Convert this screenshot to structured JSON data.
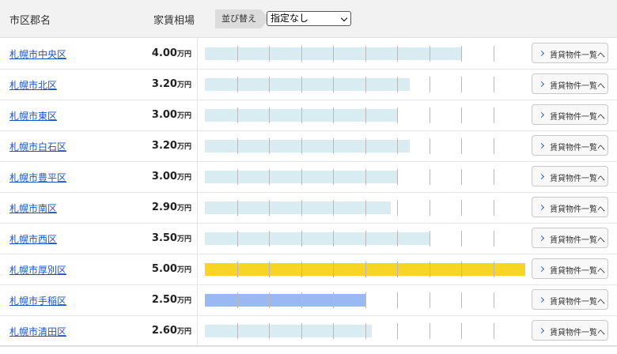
{
  "header": {
    "ward_column": "市区郡名",
    "rent_column": "家賃相場",
    "sort_label": "並び替え",
    "sort_selected": "指定なし"
  },
  "unit": "万円",
  "scale_max": 5.0,
  "bar_colors": {
    "default": "#d8ecf2",
    "max": "#f7d524",
    "min": "#9ab8f2"
  },
  "rows": [
    {
      "ward": "札幌市中央区",
      "rent": "4.00",
      "value": 4.0,
      "button": "賃貸物件一覧へ",
      "highlight": "default"
    },
    {
      "ward": "札幌市北区",
      "rent": "3.20",
      "value": 3.2,
      "button": "賃貸物件一覧へ",
      "highlight": "default"
    },
    {
      "ward": "札幌市東区",
      "rent": "3.00",
      "value": 3.0,
      "button": "賃貸物件一覧へ",
      "highlight": "default"
    },
    {
      "ward": "札幌市白石区",
      "rent": "3.20",
      "value": 3.2,
      "button": "賃貸物件一覧へ",
      "highlight": "default"
    },
    {
      "ward": "札幌市豊平区",
      "rent": "3.00",
      "value": 3.0,
      "button": "賃貸物件一覧へ",
      "highlight": "default"
    },
    {
      "ward": "札幌市南区",
      "rent": "2.90",
      "value": 2.9,
      "button": "賃貸物件一覧へ",
      "highlight": "default"
    },
    {
      "ward": "札幌市西区",
      "rent": "3.50",
      "value": 3.5,
      "button": "賃貸物件一覧へ",
      "highlight": "default"
    },
    {
      "ward": "札幌市厚別区",
      "rent": "5.00",
      "value": 5.0,
      "button": "賃貸物件一覧へ",
      "highlight": "max"
    },
    {
      "ward": "札幌市手稲区",
      "rent": "2.50",
      "value": 2.5,
      "button": "賃貸物件一覧へ",
      "highlight": "min"
    },
    {
      "ward": "札幌市清田区",
      "rent": "2.60",
      "value": 2.6,
      "button": "賃貸物件一覧へ",
      "highlight": "default"
    }
  ]
}
